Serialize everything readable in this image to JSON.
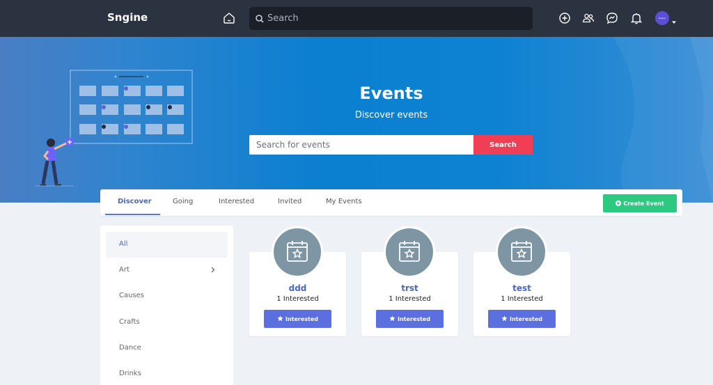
{
  "navbar": {
    "logo": "Sngine",
    "search_placeholder": "Search",
    "icons": [
      "home-icon",
      "add-circle-icon",
      "users-icon",
      "messenger-icon",
      "bell-icon"
    ],
    "avatar_text": "Sngine"
  },
  "hero": {
    "title": "Events",
    "subtitle": "Discover events",
    "search_placeholder": "Search for events",
    "search_button": "Search"
  },
  "tabs": {
    "items": [
      {
        "label": "Discover"
      },
      {
        "label": "Going"
      },
      {
        "label": "Interested"
      },
      {
        "label": "Invited"
      },
      {
        "label": "My Events"
      }
    ],
    "active_index": 0,
    "create_label": "Create Event"
  },
  "sidebar": {
    "items": [
      {
        "label": "All"
      },
      {
        "label": "Art"
      },
      {
        "label": "Causes"
      },
      {
        "label": "Crafts"
      },
      {
        "label": "Dance"
      },
      {
        "label": "Drinks"
      }
    ]
  },
  "events": [
    {
      "title": "ddd",
      "interested_text": "1 Interested",
      "button_label": "Interested"
    },
    {
      "title": "trst",
      "interested_text": "1 Interested",
      "button_label": "Interested"
    },
    {
      "title": "test",
      "interested_text": "1 Interested",
      "button_label": "Interested"
    }
  ],
  "colors": {
    "navbar": "#2b3240",
    "hero": "#0b7fd0",
    "search_button": "#f03e54",
    "create_button": "#2ec981",
    "interested_button": "#5b6fe0",
    "accent_text": "#4767c2"
  }
}
